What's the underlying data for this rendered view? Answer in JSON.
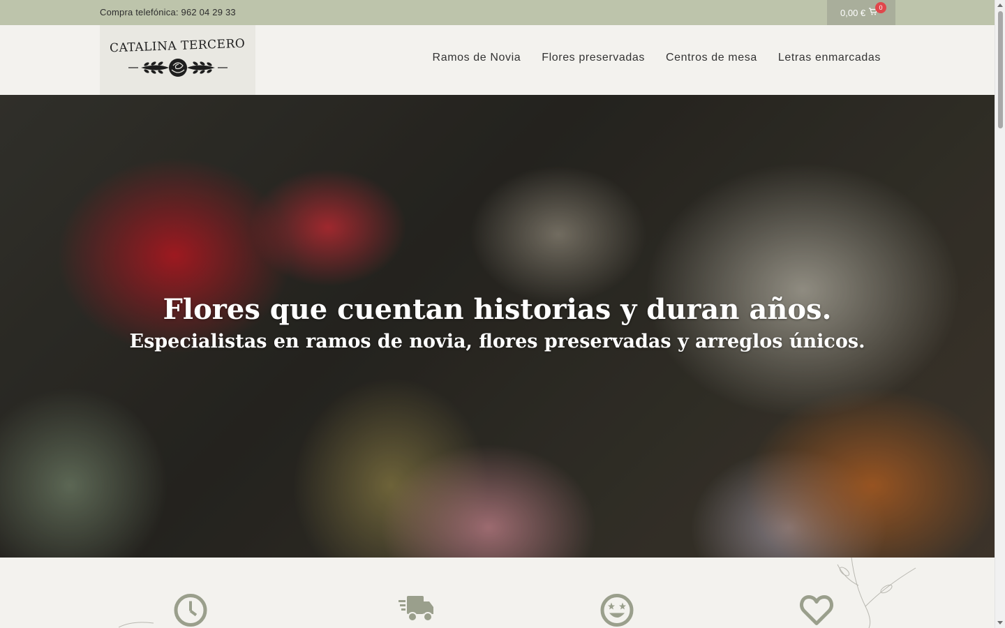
{
  "topbar": {
    "phone_text": "Compra telefónica: 962 04 29 33",
    "cart_total": "0,00 €",
    "cart_count": "0"
  },
  "header": {
    "logo_text": "CATALINA TERCERO",
    "nav": [
      {
        "label": "Ramos de Novia"
      },
      {
        "label": "Flores preservadas"
      },
      {
        "label": "Centros de mesa"
      },
      {
        "label": "Letras enmarcadas"
      }
    ]
  },
  "hero": {
    "title": "Flores que cuentan historias y duran años.",
    "subtitle": "Especialistas en ramos de novia, flores preservadas y arreglos únicos."
  },
  "features": {
    "icons": [
      "clock-icon",
      "truck-icon",
      "star-eyes-face-icon",
      "heart-icon"
    ]
  },
  "colors": {
    "topbar_bg": "#bdc4ab",
    "cart_bg": "#a9ae9b",
    "badge": "#e0474c",
    "page_bg": "#f3f2ee",
    "icon_color": "#9a9f8c"
  }
}
